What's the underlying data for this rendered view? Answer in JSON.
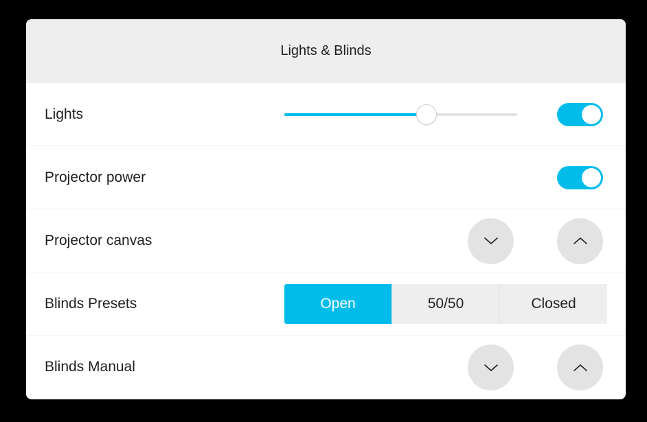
{
  "panel": {
    "title": "Lights & Blinds"
  },
  "rows": {
    "lights": {
      "label": "Lights",
      "slider_value_percent": 61,
      "toggle_on": true
    },
    "projector_power": {
      "label": "Projector power",
      "toggle_on": true
    },
    "projector_canvas": {
      "label": "Projector canvas",
      "down_icon": "chevron-down-icon",
      "up_icon": "chevron-up-icon"
    },
    "blinds_presets": {
      "label": "Blinds Presets",
      "options": [
        "Open",
        "50/50",
        "Closed"
      ],
      "selected": "Open"
    },
    "blinds_manual": {
      "label": "Blinds Manual",
      "down_icon": "chevron-down-icon",
      "up_icon": "chevron-up-icon"
    }
  },
  "colors": {
    "accent": "#00bceb",
    "header_bg": "#eeeeee",
    "button_bg": "#e3e3e3",
    "page_bg": "#000000"
  }
}
